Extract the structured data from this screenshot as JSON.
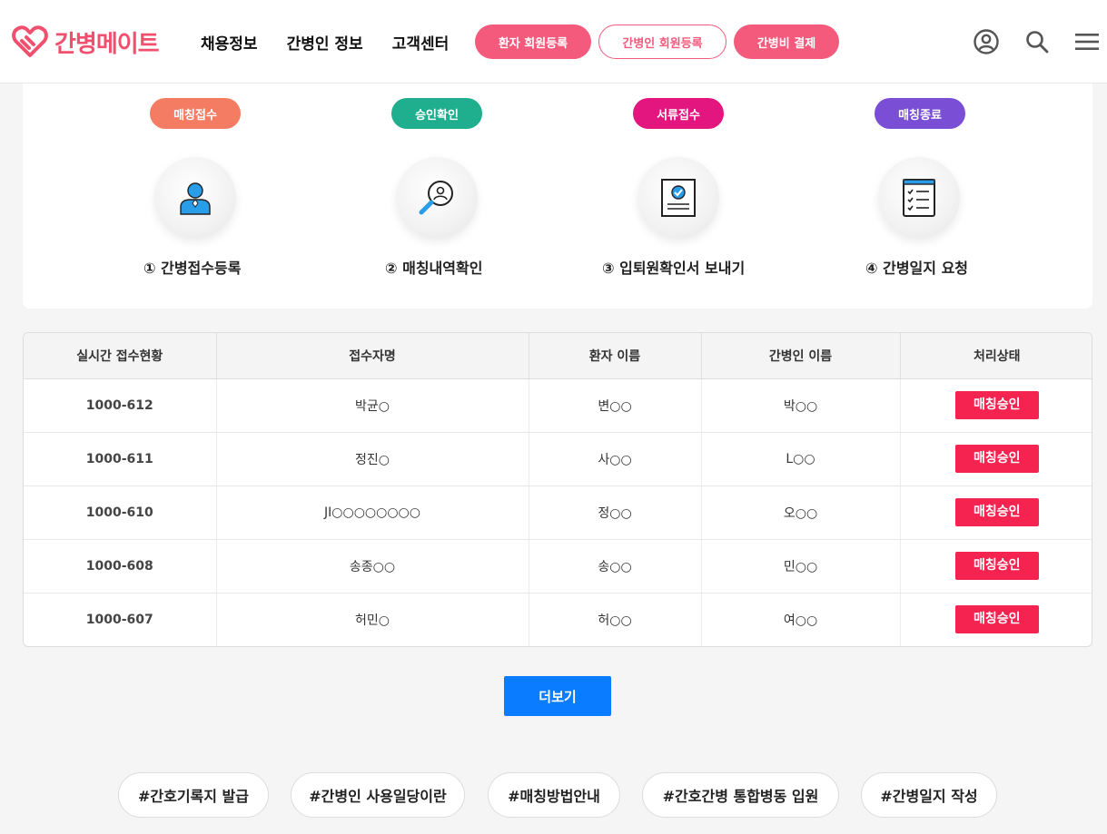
{
  "brand": {
    "name": "간병메이트",
    "color": "#f0506e"
  },
  "nav": {
    "items": [
      "채용정보",
      "간병인 정보",
      "고객센터"
    ]
  },
  "header_buttons": {
    "patient_register": "환자 회원등록",
    "caregiver_register": "간병인 회원등록",
    "payment": "간병비 결제"
  },
  "header_icons": [
    "user-icon",
    "search-icon",
    "menu-icon"
  ],
  "steps": [
    {
      "badge": "매칭접수",
      "badge_color": "#f47c62",
      "label": "① 간병접수등록",
      "icon": "person-icon"
    },
    {
      "badge": "승인확인",
      "badge_color": "#1fae8e",
      "label": "② 매칭내역확인",
      "icon": "magnifier-person-icon"
    },
    {
      "badge": "서류접수",
      "badge_color": "#e3157e",
      "label": "③ 입퇴원확인서 보내기",
      "icon": "certificate-icon"
    },
    {
      "badge": "매칭종료",
      "badge_color": "#7a4fd6",
      "label": "④ 간병일지 요청",
      "icon": "checklist-icon"
    }
  ],
  "table": {
    "headers": [
      "실시간 접수현황",
      "접수자명",
      "환자 이름",
      "간병인 이름",
      "처리상태"
    ],
    "rows": [
      {
        "id": "1000-612",
        "applicant": "박균○",
        "patient": "변○○",
        "caregiver": "박○○",
        "status": "매칭승인"
      },
      {
        "id": "1000-611",
        "applicant": "정진○",
        "patient": "사○○",
        "caregiver": "L○○",
        "status": "매칭승인"
      },
      {
        "id": "1000-610",
        "applicant": "JI○○○○○○○○",
        "patient": "정○○",
        "caregiver": "오○○",
        "status": "매칭승인"
      },
      {
        "id": "1000-608",
        "applicant": "송종○○",
        "patient": "송○○",
        "caregiver": "민○○",
        "status": "매칭승인"
      },
      {
        "id": "1000-607",
        "applicant": "허민○",
        "patient": "허○○",
        "caregiver": "여○○",
        "status": "매칭승인"
      }
    ]
  },
  "more_button": "더보기",
  "tags": [
    "#간호기록지 발급",
    "#간병인 사용일당이란",
    "#매칭방법안내",
    "#간호간병 통합병동 입원",
    "#간병일지 작성"
  ]
}
